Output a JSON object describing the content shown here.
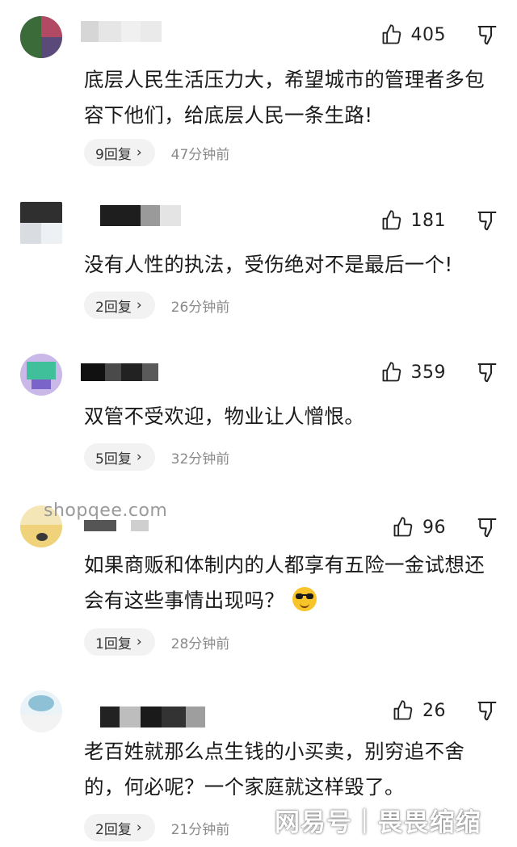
{
  "comments": [
    {
      "likes": "405",
      "text": "底层人民生活压力大，希望城市的管理者多包容下他们，给底层人民一条生路!",
      "replies": "9回复",
      "time": "47分钟前"
    },
    {
      "likes": "181",
      "text": "没有人性的执法，受伤绝对不是最后一个!",
      "replies": "2回复",
      "time": "26分钟前"
    },
    {
      "likes": "359",
      "text": "双管不受欢迎，物业让人憎恨。",
      "replies": "5回复",
      "time": "32分钟前"
    },
    {
      "likes": "96",
      "text": "如果商贩和体制内的人都享有五险一金试想还会有这些事情出现吗？",
      "replies": "1回复",
      "time": "28分钟前"
    },
    {
      "likes": "26",
      "text": "老百姓就那么点生钱的小买卖，别穷追不舍的，何必呢？一个家庭就这样毁了。",
      "replies": "2回复",
      "time": "21分钟前"
    }
  ],
  "reply_chevron": "›",
  "watermark": "shopqee.com",
  "brand": {
    "left": "网易号",
    "sep": "|",
    "right": "畏畏缩缩"
  },
  "icons": {
    "like": "thumbs-up-icon",
    "dislike": "thumbs-down-icon",
    "emoji": "sunglasses-emoji-icon"
  }
}
